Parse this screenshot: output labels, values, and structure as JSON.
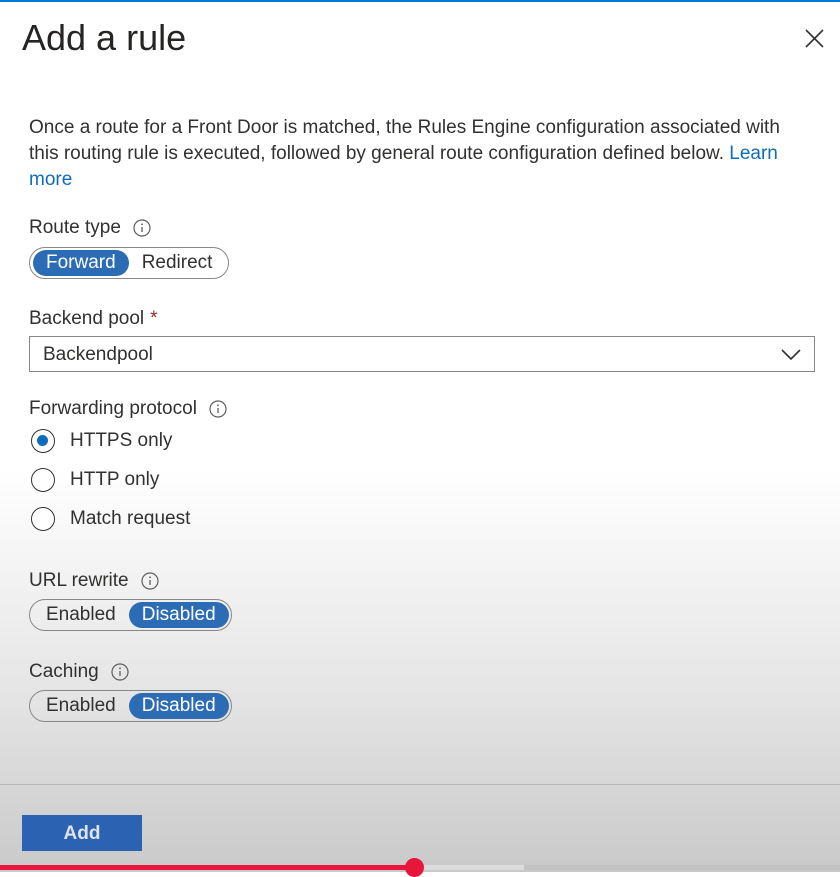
{
  "panel": {
    "title": "Add a rule",
    "close_icon": "close-icon"
  },
  "description": {
    "text": "Once a route for a Front Door is matched, the Rules Engine configuration associated with this routing rule is executed, followed by general route configuration defined below.",
    "link": "Learn more"
  },
  "route_type": {
    "label": "Route type",
    "options": [
      "Forward",
      "Redirect"
    ],
    "selected": "Forward"
  },
  "backend_pool": {
    "label": "Backend pool",
    "required_mark": "*",
    "value": "Backendpool"
  },
  "forwarding_protocol": {
    "label": "Forwarding protocol",
    "options": [
      "HTTPS only",
      "HTTP only",
      "Match request"
    ],
    "selected": "HTTPS only"
  },
  "url_rewrite": {
    "label": "URL rewrite",
    "options": [
      "Enabled",
      "Disabled"
    ],
    "selected": "Disabled"
  },
  "caching": {
    "label": "Caching",
    "options": [
      "Enabled",
      "Disabled"
    ],
    "selected": "Disabled"
  },
  "footer": {
    "add_label": "Add"
  },
  "video_progress": {
    "played_fraction": 0.493,
    "buffered_fraction": 0.624
  },
  "colors": {
    "accent": "#2b6cb5",
    "link": "#0f6cbd",
    "required": "#a4262c",
    "progress": "#e8163a"
  }
}
